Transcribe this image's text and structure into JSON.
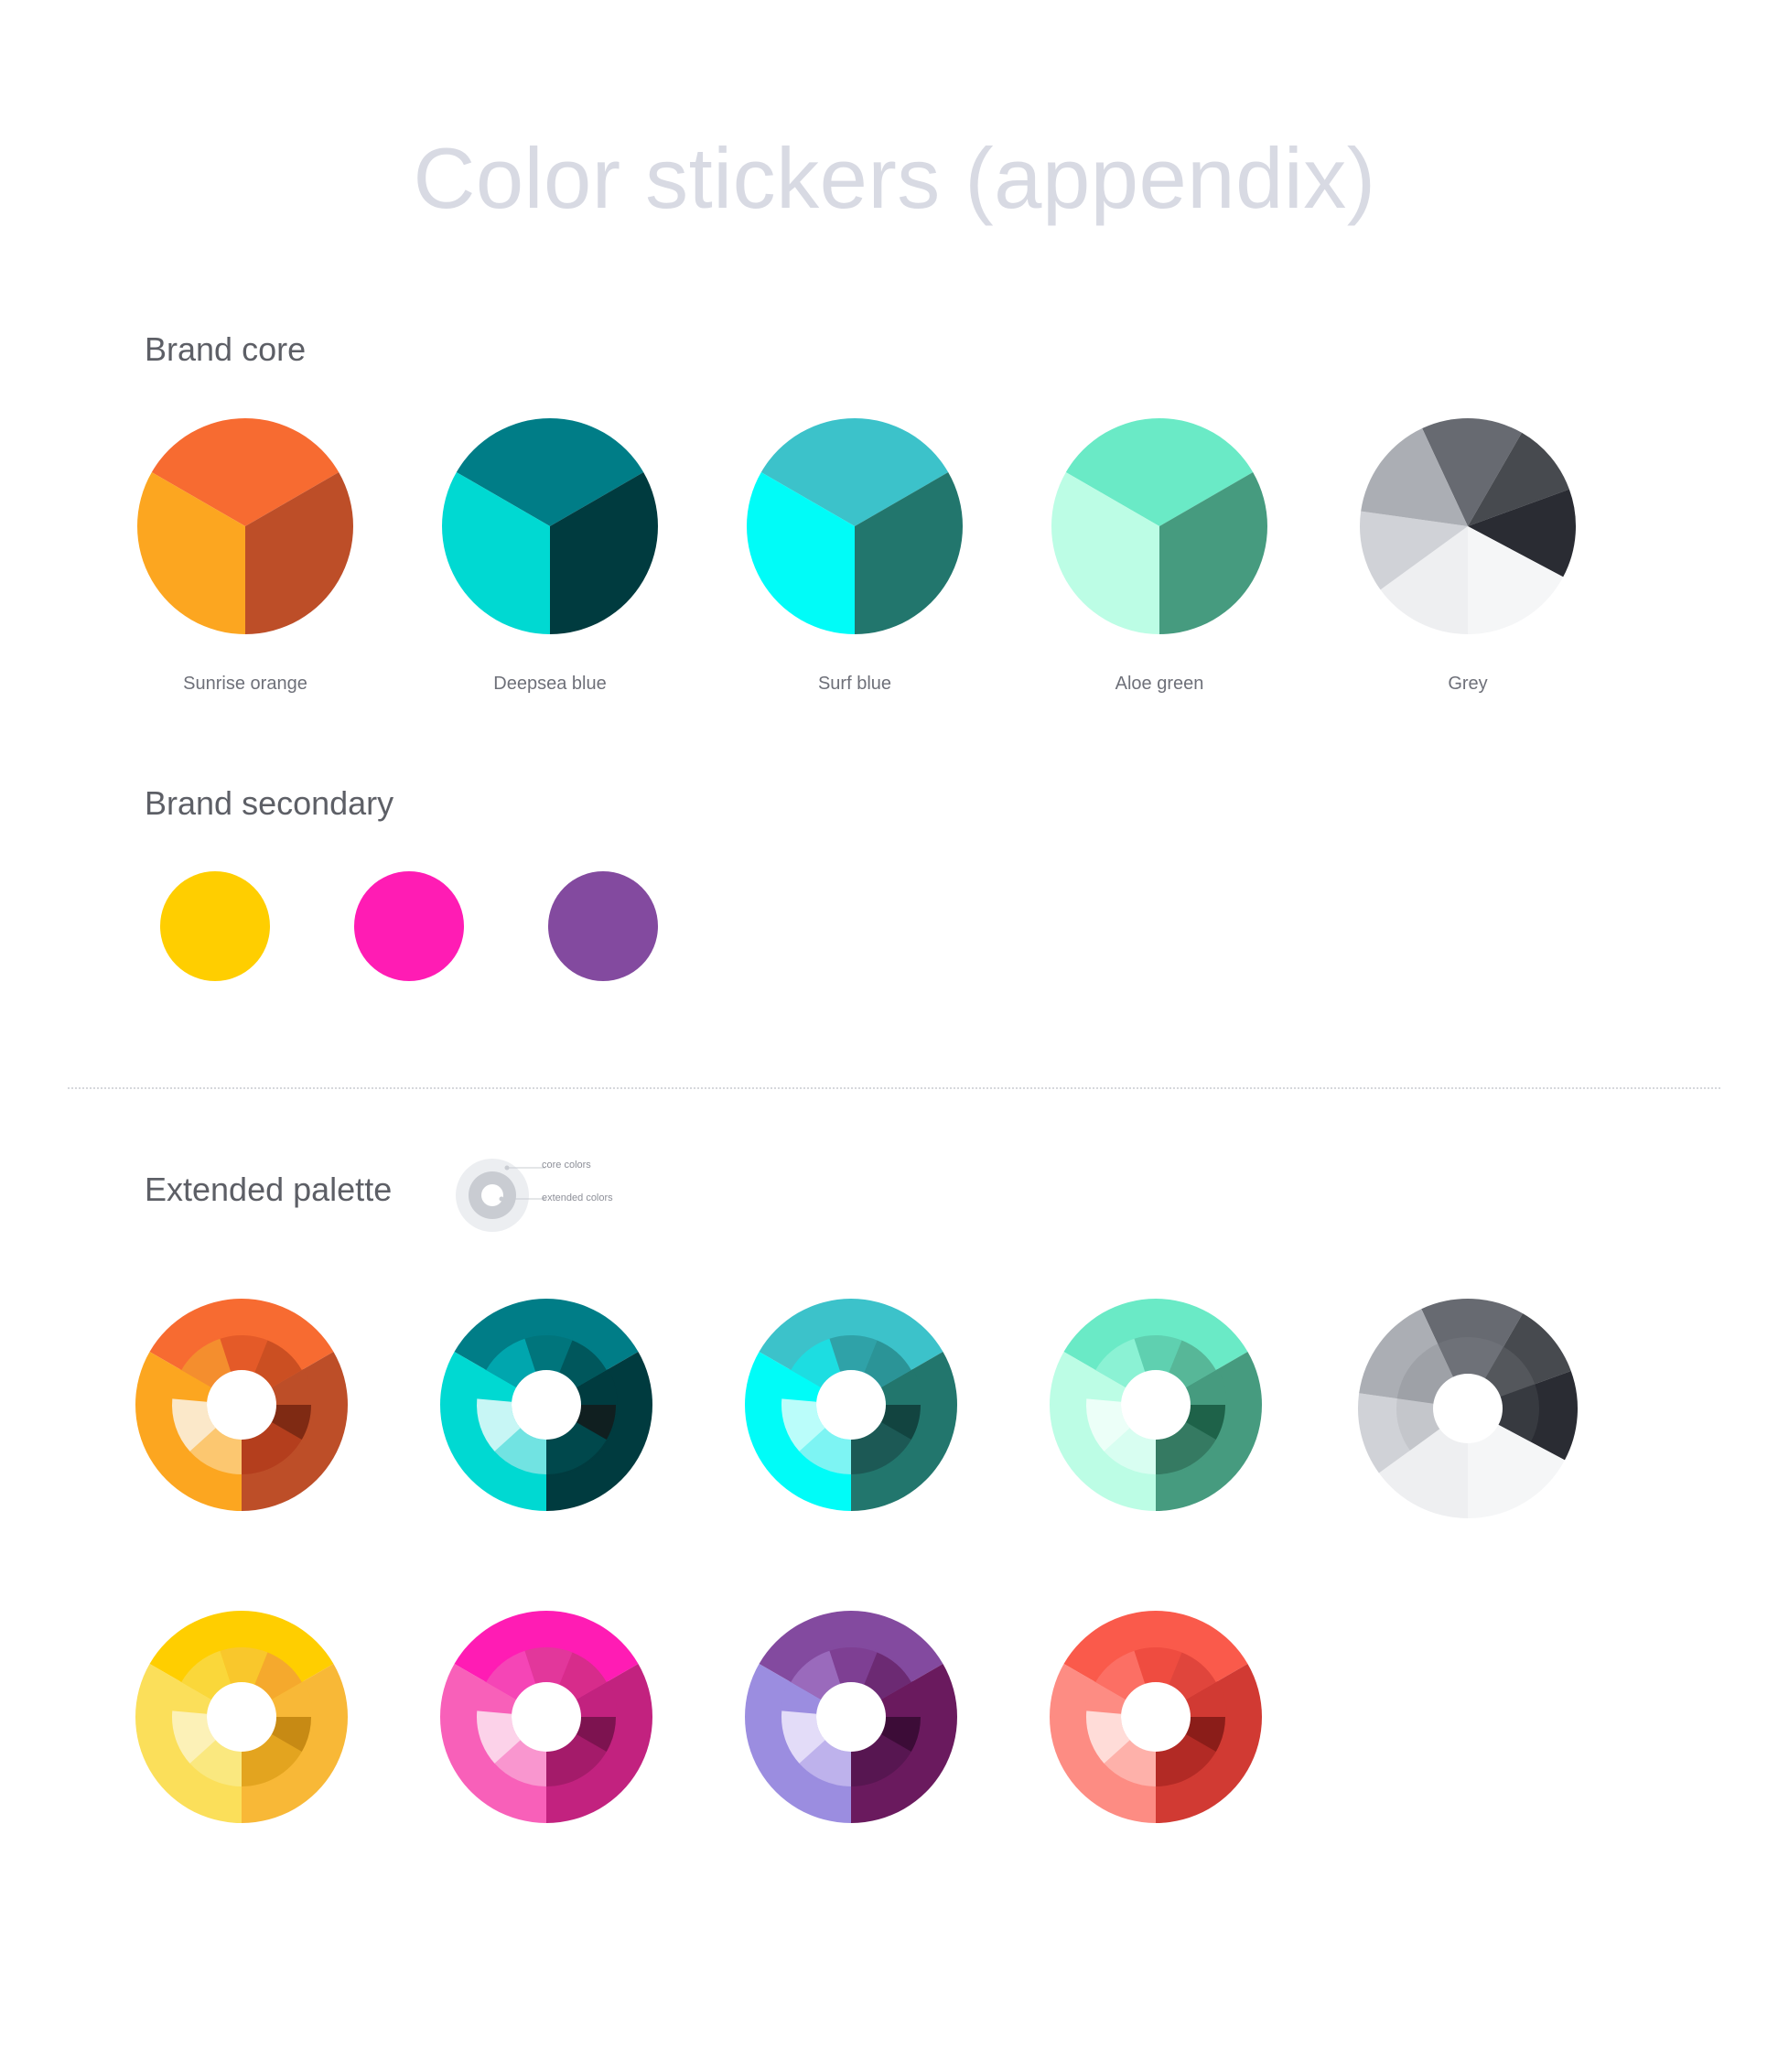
{
  "title": "Color stickers (appendix)",
  "brand_core": {
    "heading": "Brand core",
    "stickers": [
      {
        "label": "Sunrise orange",
        "top": "#F76B31",
        "left": "#FCA620",
        "right": "#BD4E28"
      },
      {
        "label": "Deepsea blue",
        "top": "#007D87",
        "left": "#00D9D2",
        "right": "#003B3F"
      },
      {
        "label": "Surf blue",
        "top": "#3CC2CA",
        "left": "#00FCF8",
        "right": "#22766D"
      },
      {
        "label": "Aloe green",
        "top": "#6AEAC6",
        "left": "#BCFDE5",
        "right": "#469B7F"
      },
      {
        "label": "Grey",
        "colors": [
          "#676A71",
          "#474A4F",
          "#2A2C33",
          "#F5F6F7",
          "#EEEFF1",
          "#D0D2D7",
          "#ABAEB4"
        ]
      }
    ]
  },
  "brand_secondary": {
    "heading": "Brand secondary",
    "colors": [
      "#FFCE00",
      "#FF1CB4",
      "#834A9F"
    ]
  },
  "extended": {
    "heading": "Extended palette",
    "legend": {
      "core_label": "core colors",
      "extended_label": "extended colors"
    },
    "row1": [
      {
        "name": "sunrise-orange",
        "outer": [
          "#F76B31",
          "#FCA620",
          "#BD4E28"
        ],
        "inner": [
          "#F48E2E",
          "#E45A28",
          "#CB4F22",
          "#FCC770",
          "#FBE8C9",
          "#B43E1D",
          "#7F2A13"
        ]
      },
      {
        "name": "deepsea-blue",
        "outer": [
          "#007D87",
          "#00D9D2",
          "#003B3F"
        ],
        "inner": [
          "#00A6AE",
          "#00757C",
          "#00575C",
          "#71E3E2",
          "#C7F6F5",
          "#00484C",
          "#101F20"
        ]
      },
      {
        "name": "surf-blue",
        "outer": [
          "#3CC2CA",
          "#00FCF8",
          "#22766D"
        ],
        "inner": [
          "#1DDDE1",
          "#2FA2A8",
          "#2B9497",
          "#7DF4F3",
          "#BAFDFA",
          "#1C5955",
          "#124440"
        ]
      },
      {
        "name": "aloe-green",
        "outer": [
          "#6AEAC6",
          "#BCFDE5",
          "#469B7F"
        ],
        "inner": [
          "#8BF2D4",
          "#5FD0B0",
          "#57B798",
          "#D8FEF1",
          "#ECFFF8",
          "#357A62",
          "#1E6249"
        ]
      },
      {
        "name": "grey",
        "outer": [
          "#676A71",
          "#474A4F",
          "#2A2C33",
          "#F5F6F7",
          "#EEEFF1",
          "#D0D2D7",
          "#ABAEB4"
        ],
        "inner": [
          "#6E7178",
          "#54575C",
          "#373A40",
          "#F5F6F7",
          "#EEEFF1",
          "#C4C6CB",
          "#9EA1A7"
        ]
      }
    ],
    "row2": [
      {
        "name": "yellow",
        "outer": [
          "#FFCE00",
          "#FBDF5A",
          "#F8B837"
        ],
        "inner": [
          "#FAD73A",
          "#F9C72C",
          "#F5A92D",
          "#FAE87F",
          "#FCF1B7",
          "#E3A41F",
          "#C78A14"
        ]
      },
      {
        "name": "pink",
        "outer": [
          "#FF1CB4",
          "#F860B9",
          "#C2227F"
        ],
        "inner": [
          "#F545B6",
          "#E2379B",
          "#D72C8B",
          "#F996CF",
          "#FCD2E9",
          "#A41B6A",
          "#7D1350"
        ]
      },
      {
        "name": "purple",
        "outer": [
          "#834A9F",
          "#9B8DE0",
          "#6A1A5E"
        ],
        "inner": [
          "#9A6ABC",
          "#7E3F93",
          "#6C2A73",
          "#BEB2EC",
          "#E3DCF8",
          "#571651",
          "#3C0C37"
        ]
      },
      {
        "name": "red",
        "outer": [
          "#FA5A4B",
          "#FD8C83",
          "#D13A33"
        ],
        "inner": [
          "#FC6F64",
          "#EF4C40",
          "#E0453C",
          "#FEB1AA",
          "#FFDCD8",
          "#B22A25",
          "#8B1D19"
        ]
      }
    ]
  }
}
